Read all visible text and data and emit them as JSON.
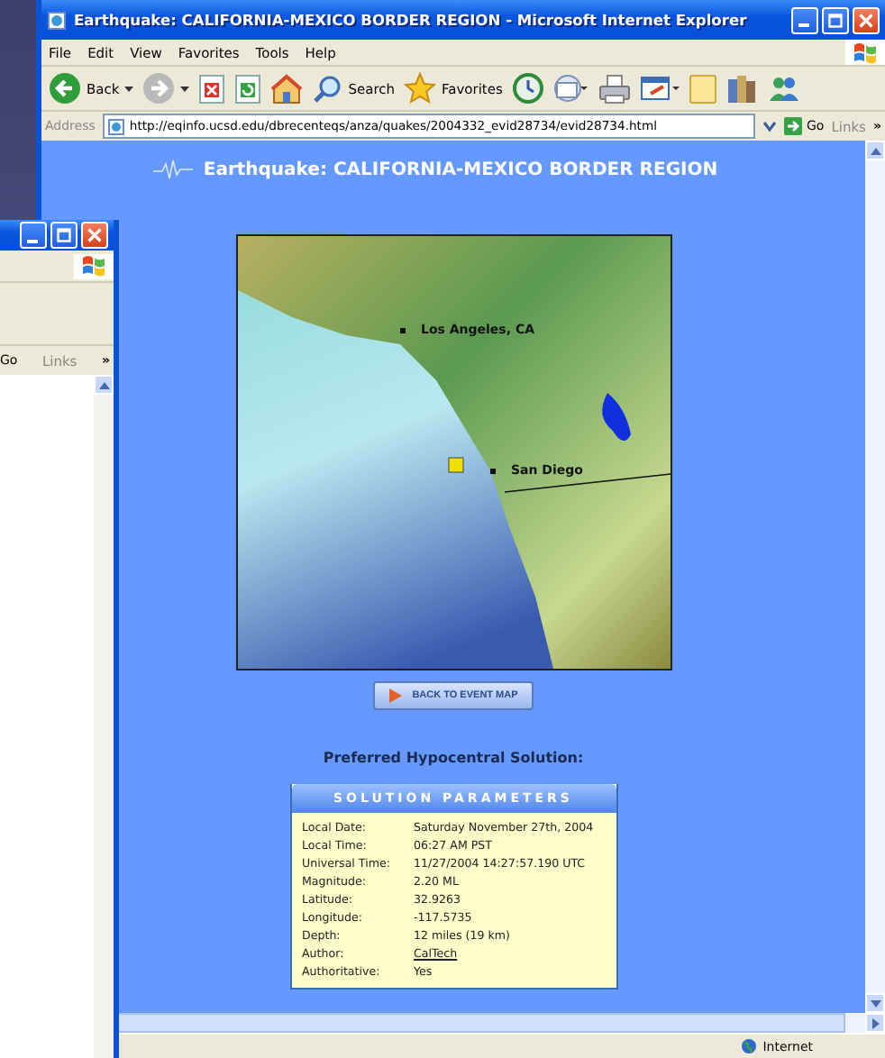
{
  "back_window": {
    "go": "Go",
    "links": "Links",
    "links_more": "»"
  },
  "ie_window": {
    "title": "Earthquake: CALIFORNIA-MEXICO BORDER REGION - Microsoft Internet Explorer",
    "menu": [
      "File",
      "Edit",
      "View",
      "Favorites",
      "Tools",
      "Help"
    ],
    "toolbar": [
      {
        "kind": "back",
        "label": "Back"
      },
      {
        "kind": "forward"
      },
      {
        "kind": "stop"
      },
      {
        "kind": "refresh"
      },
      {
        "kind": "home"
      },
      {
        "kind": "search",
        "label": "Search"
      },
      {
        "kind": "favorites",
        "label": "Favorites"
      },
      {
        "kind": "history"
      },
      {
        "kind": "mail"
      },
      {
        "kind": "print"
      },
      {
        "kind": "edit"
      },
      {
        "kind": "folder"
      },
      {
        "kind": "research"
      },
      {
        "kind": "messenger"
      }
    ],
    "address": {
      "label": "Address",
      "url": "http://eqinfo.ucsd.edu/dbrecenteqs/anza/quakes/2004332_evid28734/evid28734.html"
    },
    "go": "Go",
    "links": "Links",
    "links_more": "»",
    "status_bar": {
      "zone": "Internet"
    }
  },
  "page": {
    "heading": "Earthquake: CALIFORNIA-MEXICO BORDER REGION",
    "map_labels": [
      "Los Angeles, CA",
      "San Diego"
    ],
    "back_button": "BACK TO EVENT MAP",
    "subtitle": "Preferred Hypocentral Solution:",
    "panel_title": "SOLUTION PARAMETERS",
    "rows": [
      {
        "label": "Local Date:",
        "value": "Saturday November 27th, 2004",
        "kind": "text"
      },
      {
        "label": "Local Time:",
        "value": "06:27 AM PST",
        "kind": "text"
      },
      {
        "label": "Universal Time:",
        "value": "11/27/2004 14:27:57.190 UTC",
        "kind": "text"
      },
      {
        "label": "Magnitude:",
        "value": "2.20 ML",
        "kind": "text"
      },
      {
        "label": "Latitude:",
        "value": "32.9263",
        "kind": "text"
      },
      {
        "label": "Longitude:",
        "value": "-117.5735",
        "kind": "text"
      },
      {
        "label": "Depth:",
        "value": "12 miles (19 km)",
        "kind": "text"
      },
      {
        "label": "Author:",
        "value": "CalTech",
        "kind": "link"
      },
      {
        "label": "Authoritative:",
        "value": "Yes",
        "kind": "text"
      }
    ]
  }
}
